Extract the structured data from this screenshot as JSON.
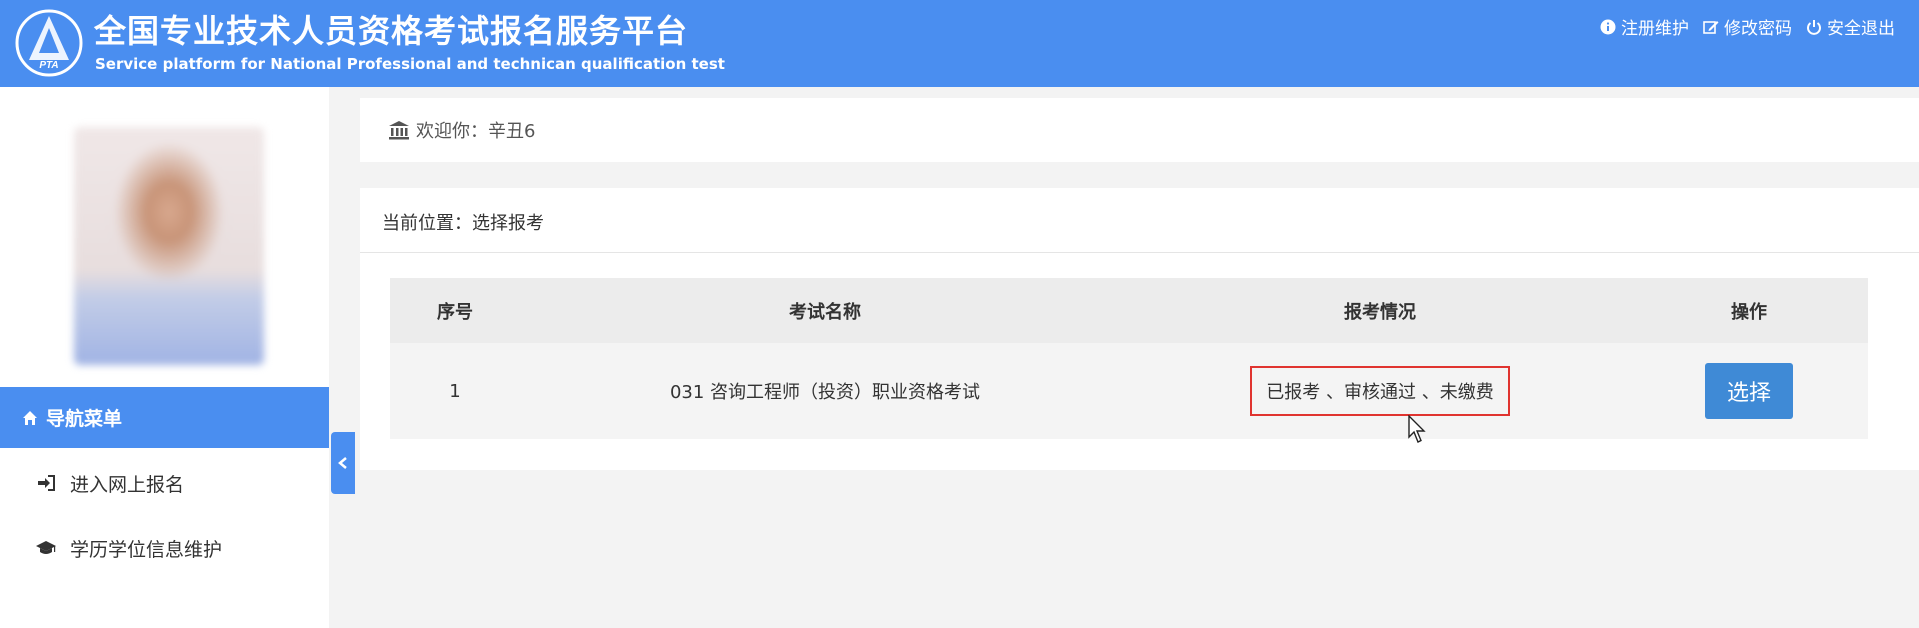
{
  "header": {
    "title_cn": "全国专业技术人员资格考试报名服务平台",
    "title_en": "Service platform for National Professional and technican qualification test",
    "logo_text": "PTA",
    "links": [
      {
        "label": "注册维护",
        "icon": "info-circle-icon"
      },
      {
        "label": "修改密码",
        "icon": "edit-icon"
      },
      {
        "label": "安全退出",
        "icon": "power-icon"
      }
    ]
  },
  "sidebar": {
    "nav_title": "导航菜单",
    "items": [
      {
        "label": "进入网上报名",
        "icon": "sign-in-icon"
      },
      {
        "label": "学历学位信息维护",
        "icon": "graduation-cap-icon"
      }
    ]
  },
  "welcome": {
    "text": "欢迎你：辛丑6"
  },
  "main": {
    "breadcrumb": "当前位置：选择报考",
    "table": {
      "headers": [
        "序号",
        "考试名称",
        "报考情况",
        "操作"
      ],
      "rows": [
        {
          "index": "1",
          "exam_name": "031 咨询工程师（投资）职业资格考试",
          "status": "已报考 、审核通过 、未缴费",
          "action": "选择"
        }
      ]
    }
  },
  "colors": {
    "header_bg": "#4a8ef0",
    "button_bg": "#3f8ad6",
    "highlight_border": "#e0332f"
  }
}
